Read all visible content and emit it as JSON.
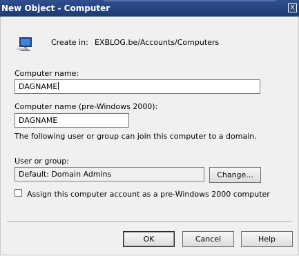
{
  "window": {
    "title": "New Object - Computer",
    "close_glyph": "X"
  },
  "header": {
    "icon": "computer-monitor-icon",
    "create_in_label": "Create in:",
    "create_in_value": "EXBLOG.be/Accounts/Computers"
  },
  "form": {
    "computer_name_label": "Computer name:",
    "computer_name_value": "DAGNAME",
    "pre2000_label": "Computer name (pre-Windows 2000):",
    "pre2000_value": "DAGNAME",
    "info_text": "The following user or group can join this computer to a domain.",
    "user_group_label": "User or group:",
    "user_group_value": "Default: Domain Admins",
    "change_button": "Change...",
    "checkbox_label": "Assign this computer account as a pre-Windows 2000 computer",
    "checkbox_checked": false
  },
  "buttons": {
    "ok": "OK",
    "cancel": "Cancel",
    "help": "Help"
  }
}
